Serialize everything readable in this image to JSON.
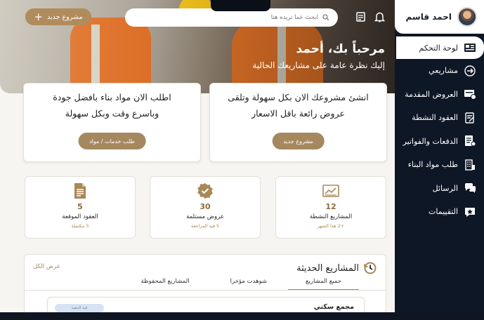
{
  "profile": {
    "name": "احمد قاسم",
    "avatar_icon": "user-avatar"
  },
  "sidebar": {
    "items": [
      {
        "label": "لوحة التحكم",
        "icon": "dashboard-icon",
        "active": true
      },
      {
        "label": "مشاريعي",
        "icon": "projects-icon"
      },
      {
        "label": "العروض المقدمة",
        "icon": "offers-icon"
      },
      {
        "label": "العقود النشطة",
        "icon": "contract-icon"
      },
      {
        "label": "الدفعات والفواتير",
        "icon": "invoice-icon"
      },
      {
        "label": "طلب مواد البناء",
        "icon": "building-icon"
      },
      {
        "label": "الرسائل",
        "icon": "chat-icon"
      },
      {
        "label": "التقييمات",
        "icon": "rating-icon"
      }
    ]
  },
  "header": {
    "new_project_label": "مشروع جديد",
    "search_placeholder": "ابحث عما تريده هنا"
  },
  "hero": {
    "title": "مرحباً بك، أحمد",
    "subtitle": "إليك نظرة عامة على مشاريعك الحالية"
  },
  "promos": [
    {
      "text": "انشئ مشروعك الان بكل سهولة وتلقى عروض رائعة باقل الاسعار",
      "button": "مشروع جديد"
    },
    {
      "text": "اطلب الان مواد بناء بافضل جودة وباسرع وقت وبكل سهولة",
      "button": "طلب خدمات / مواد"
    }
  ],
  "stats": [
    {
      "value": "12",
      "label": "المشاريع النشطة",
      "sub": "+2 هذا الشهر",
      "icon": "chart-icon"
    },
    {
      "value": "30",
      "label": "عروض مستلمة",
      "sub": "5 قيد المراجعة",
      "icon": "check-badge-icon"
    },
    {
      "value": "5",
      "label": "العقود الموقعة",
      "sub": "3 مكتملة",
      "icon": "document-icon"
    }
  ],
  "projects": {
    "title": "المشاريع الحديثة",
    "view_all": "عرض الكل",
    "tabs": [
      "جميع المشاريع",
      "شوهدت مؤخرا",
      "المشاريع المحفوظة"
    ],
    "items": [
      {
        "name": "مجمع سكني",
        "status": "قيد التنفيذ"
      }
    ]
  },
  "colors": {
    "accent": "#a6885f",
    "sidebar": "#0e1726"
  }
}
